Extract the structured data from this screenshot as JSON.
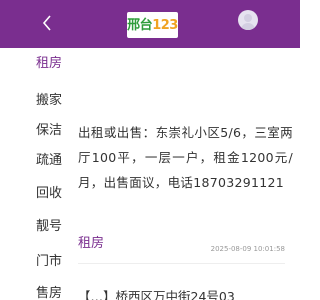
{
  "header": {
    "logo_cn": "邢台",
    "logo_num": "123",
    "back_icon": "chevron-left-icon",
    "avatar_icon": "user-avatar-icon"
  },
  "sidebar": {
    "items": [
      {
        "label": "租房",
        "active": true
      },
      {
        "label": "搬家",
        "active": false
      },
      {
        "label": "保洁",
        "active": false
      },
      {
        "label": "疏通",
        "active": false
      },
      {
        "label": "回收",
        "active": false
      },
      {
        "label": "靓号",
        "active": false
      },
      {
        "label": "门市",
        "active": false
      },
      {
        "label": "售房",
        "active": false
      }
    ]
  },
  "posts": [
    {
      "text": "出租或出售：东崇礼小区5/6，三室两厅100平，一层一户，租金1200元/月，出售面议，电话18703291121",
      "tag": "租房",
      "time": "2025-08-09 10:01:58"
    },
    {
      "text": "【…】桥西区万中街24号03"
    }
  ],
  "colors": {
    "brand": "#7a2e8f",
    "logo_green": "#2e9c3a",
    "logo_orange": "#f0a322",
    "text": "#333333",
    "muted": "#999999"
  }
}
